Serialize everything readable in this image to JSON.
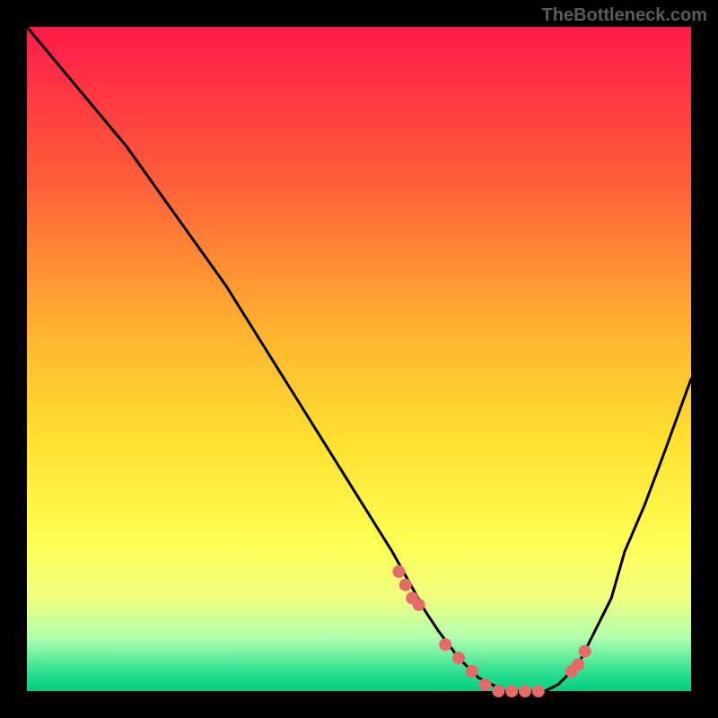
{
  "watermark": "TheBottleneck.com",
  "chart_data": {
    "type": "line",
    "title": "",
    "xlabel": "",
    "ylabel": "",
    "xlim": [
      0,
      100
    ],
    "ylim": [
      0,
      100
    ],
    "curve": {
      "x": [
        0,
        5,
        10,
        15,
        20,
        25,
        30,
        35,
        40,
        45,
        50,
        55,
        60,
        62,
        65,
        68,
        70,
        72,
        75,
        78,
        80,
        83,
        85,
        88,
        90,
        93,
        96,
        100
      ],
      "y": [
        100,
        94,
        88,
        82,
        75,
        68,
        61,
        53,
        45,
        37,
        29,
        21,
        12,
        9,
        5,
        2,
        1,
        0,
        0,
        0,
        1,
        4,
        8,
        14,
        21,
        28,
        36,
        47
      ]
    },
    "markers": {
      "x": [
        56,
        57,
        58,
        59,
        63,
        65,
        67,
        69,
        71,
        73,
        75,
        77,
        82,
        83,
        84
      ],
      "y": [
        18,
        16,
        14,
        13,
        7,
        5,
        3,
        1,
        0,
        0,
        0,
        0,
        3,
        4,
        6
      ],
      "color": "#e76a6a",
      "size": 7
    },
    "gradient_stops": [
      {
        "pos": 0,
        "color": "#ff1a4a"
      },
      {
        "pos": 22,
        "color": "#ff5a3a"
      },
      {
        "pos": 45,
        "color": "#ffb030"
      },
      {
        "pos": 62,
        "color": "#ffe030"
      },
      {
        "pos": 78,
        "color": "#ffff55"
      },
      {
        "pos": 86,
        "color": "#f0ff80"
      },
      {
        "pos": 92,
        "color": "#b0ffb0"
      },
      {
        "pos": 97,
        "color": "#30e090"
      },
      {
        "pos": 100,
        "color": "#00d080"
      }
    ]
  }
}
